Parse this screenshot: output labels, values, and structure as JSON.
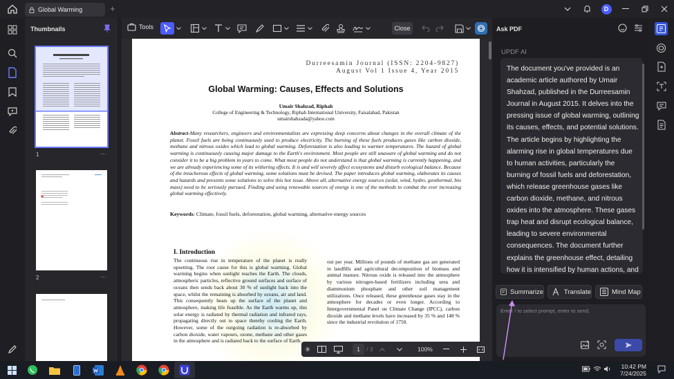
{
  "titlebar": {
    "tab_title": "Global Warming",
    "avatar_initial": "D"
  },
  "thumbnails": {
    "title": "Thumbnails",
    "pages": [
      {
        "label": "1"
      },
      {
        "label": "2"
      }
    ]
  },
  "toolbar": {
    "tools_label": "Tools",
    "close_label": "Close"
  },
  "document": {
    "journal_line1": "Durreesamin Journal (ISSN: 2204-9827)",
    "journal_line2": "August Vol 1 Issue 4, Year 2015",
    "title": "Global Warming: Causes, Effects and Solutions",
    "author": "Umair Shahzad, Riphah",
    "affiliation": "College of Engineering & Technology, Riphah International University, Faisalabad, Pakistan",
    "email": "umairshahzada@yahoo.com",
    "abstract_label": "Abstract-",
    "abstract_text": "Many researchers, engineers and environmentalists are expressing deep concerns about changes in the overall climate of the planet. Fossil fuels are being continuously used to produce electricity. The burning of these fuels produces gases like carbon dioxide, methane and nitrous oxides which lead to global warming. Deforestation is also leading to warmer temperatures. The hazard of global warming is continuously causing major damage to the Earth's environment. Most people are still unaware of global warming and do not consider it to be a big problem in years to come. What most people do not understand is that global warming is currently happening, and we are already experiencing some of its withering effects. It is and will severely affect ecosystems and disturb ecological balance. Because of the treacherous effects of global warming, some solutions must be devised. The paper introduces global warming, elaborates its causes and hazards and presents some solutions to solve this hot issue. Above all, alternative energy sources (solar, wind, hydro, geothermal, bio mass) need to be seriously pursued. Finding and using renewable sources of energy is one of the methods to combat the ever increasing global warming effectively.",
    "keywords_label": "Keywords",
    "keywords_text": ": Climate, fossil fuels, deforestation, global warming, alternative energy sources",
    "intro_heading": "I. Introduction",
    "intro_col1": "The continuous rise in temperature of the planet is really upsetting. The root cause for this is global warming. Global warming begins when sunlight reaches the Earth. The clouds, atmospheric particles, reflective ground surfaces and surface of oceans then sends back about 30 % of sunlight back into the space, whilst the remaining is absorbed by oceans, air and land. This consequently heats up the surface of the planet and atmosphere, making life feasible. As the Earth warms up, this solar energy is radiated by thermal radiation and infrared rays, propagating directly out to space thereby cooling the Earth. However, some of the outgoing radiation is re-absorbed by carbon dioxide, water vapours, ozone, methane and other gases in the atmosphere and is radiated back to the surface of Earth.",
    "intro_col2": "out per year. Millions of pounds of methane gas are generated in landfills and agricultural decomposition of biomass and animal manure. Nitrous oxide is released into the atmosphere by various nitrogen-based fertilizers including urea and diammonium phosphate and other soil management utilizations. Once released, these greenhouse gases stay in the atmosphere for decades or even longer. According to Intergovernmental Panel on Climate Change (IPCC), carbon dioxide and methane levels have increased by 35 % and 148 % since the industrial revolution of 1750."
  },
  "pagebar": {
    "current_page": "1",
    "total_pages": "/ 3",
    "zoom": "100%"
  },
  "ask_pdf": {
    "title": "Ask PDF",
    "assistant_name": "UPDF AI",
    "response": "The document you've provided is an academic article authored by Umair Shahzad, published in the Durreesamin Journal in August 2015. It delves into the pressing issue of global warming, outlining its causes, effects, and potential solutions. The article begins by highlighting the alarming rise in global temperatures due to human activities, particularly the burning of fossil fuels and deforestation, which release greenhouse gases like carbon dioxide, methane, and nitrous oxides into the atmosphere. These gases trap heat and disrupt ecological balance, leading to severe environmental consequences. The document further explains the greenhouse effect, detailing how it is intensified by human actions, and discusses",
    "actions": {
      "summarize": "Summarize",
      "translate": "Translate",
      "mindmap": "Mind Map"
    },
    "prompt_placeholder": "Enter / to select prompt, enter  to send."
  },
  "taskbar": {
    "time": "10:42 PM",
    "date": "7/24/2025"
  },
  "colors": {
    "accent": "#4c5cff",
    "panel": "#2b2b31",
    "background": "#1f1f23"
  }
}
